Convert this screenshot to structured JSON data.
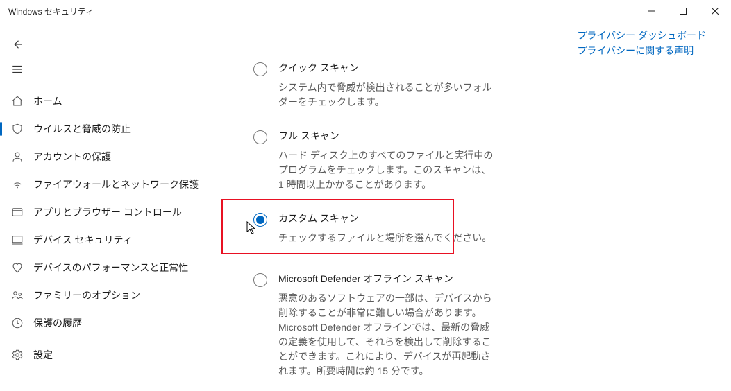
{
  "window": {
    "title": "Windows セキュリティ"
  },
  "sidebar": {
    "back": "",
    "items": [
      {
        "label": "ホーム"
      },
      {
        "label": "ウイルスと脅威の防止"
      },
      {
        "label": "アカウントの保護"
      },
      {
        "label": "ファイアウォールとネットワーク保護"
      },
      {
        "label": "アプリとブラウザー コントロール"
      },
      {
        "label": "デバイス セキュリティ"
      },
      {
        "label": "デバイスのパフォーマンスと正常性"
      },
      {
        "label": "ファミリーのオプション"
      },
      {
        "label": "保護の履歴"
      }
    ],
    "settings": "設定"
  },
  "links": {
    "dashboard": "プライバシー ダッシュボード",
    "statement": "プライバシーに関する声明"
  },
  "options": {
    "quick": {
      "title": "クイック スキャン",
      "desc": "システム内で脅威が検出されることが多いフォルダーをチェックします。"
    },
    "full": {
      "title": "フル スキャン",
      "desc": "ハード ディスク上のすべてのファイルと実行中のプログラムをチェックします。このスキャンは、1 時間以上かかることがあります。"
    },
    "custom": {
      "title": "カスタム スキャン",
      "desc": "チェックするファイルと場所を選んでください。"
    },
    "offline": {
      "title": "Microsoft Defender オフライン スキャン",
      "desc": "悪意のあるソフトウェアの一部は、デバイスから削除することが非常に難しい場合があります。Microsoft Defender オフラインでは、最新の脅威の定義を使用して、それらを検出して削除することができます。これにより、デバイスが再起動されます。所要時間は約 15 分です。"
    }
  }
}
